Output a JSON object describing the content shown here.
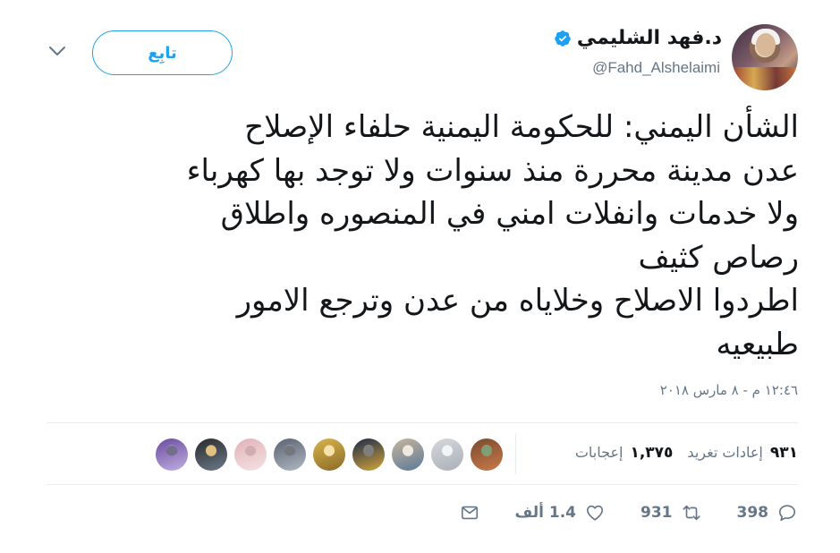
{
  "user": {
    "display_name": "د.فهد الشليمي",
    "handle": "@Fahd_Alshelaimi",
    "verified": true,
    "avatar_icon": "profile-photo"
  },
  "follow_button": {
    "label": "تابِع"
  },
  "menu": {
    "icon": "chevron-down-icon"
  },
  "tweet": {
    "text": "الشأن اليمني: للحكومة اليمنية حلفاء الإصلاح\nعدن مدينة محررة منذ سنوات ولا توجد بها كهرباء\nولا خدمات وانفلات امني في المنصوره واطلاق\nرصاص كثيف\nاطردوا الاصلاح وخلاياه من عدن وترجع الامور\nطبيعيه",
    "timestamp": "١٢:٤٦ م - ٨ مارس ٢٠١٨"
  },
  "stats": {
    "retweets": {
      "num": "٩٣١",
      "label": "إعادات تغريد"
    },
    "likes": {
      "num": "١,٣٧٥",
      "label": "إعجابات"
    }
  },
  "liker_avatars": [
    {
      "colors": [
        "#7a4a2e",
        "#c97a4a",
        "#3d6b2a"
      ]
    },
    {
      "colors": [
        "#d5d8dc",
        "#aab0b7",
        "#eceef0"
      ]
    },
    {
      "colors": [
        "#c7b59a",
        "#5b7a9a",
        "#e5dccd"
      ]
    },
    {
      "colors": [
        "#1a2a4a",
        "#d4a43a",
        "#3a3a3a"
      ]
    },
    {
      "colors": [
        "#d9b44a",
        "#8a6a2a",
        "#f2d27a"
      ]
    },
    {
      "colors": [
        "#5a6270",
        "#b0b8c4",
        "#2a2e36"
      ]
    },
    {
      "colors": [
        "#e0b2b6",
        "#f4e2e4",
        "#b88088"
      ]
    },
    {
      "colors": [
        "#2a2a2a",
        "#6a7a8a",
        "#d0a040"
      ]
    },
    {
      "colors": [
        "#6a4aa0",
        "#c0b0e0",
        "#2a2050"
      ]
    }
  ],
  "actions": {
    "reply": {
      "icon": "reply-icon",
      "count": "398"
    },
    "retweet": {
      "icon": "retweet-icon",
      "count": "931"
    },
    "like": {
      "icon": "heart-icon",
      "count": "1.4 ألف"
    },
    "dm": {
      "icon": "envelope-icon"
    }
  },
  "colors": {
    "accent": "#1da1f2",
    "muted": "#657786",
    "text": "#14171a",
    "border": "#e6ecf0"
  }
}
